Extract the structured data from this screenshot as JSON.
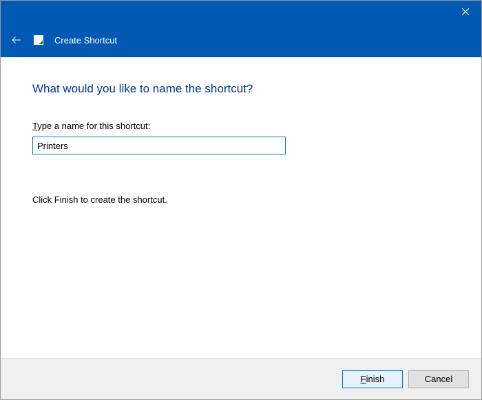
{
  "titlebar": {
    "close_icon": "close"
  },
  "header": {
    "back_icon": "back-arrow",
    "shortcut_icon": "shortcut",
    "title": "Create Shortcut"
  },
  "content": {
    "heading": "What would you like to name the shortcut?",
    "field_label_pre": "",
    "field_label_underline": "T",
    "field_label_post": "ype a name for this shortcut:",
    "input_value": "Printers",
    "instruction": "Click Finish to create the shortcut."
  },
  "footer": {
    "finish_underline": "F",
    "finish_rest": "inish",
    "cancel_label": "Cancel"
  }
}
